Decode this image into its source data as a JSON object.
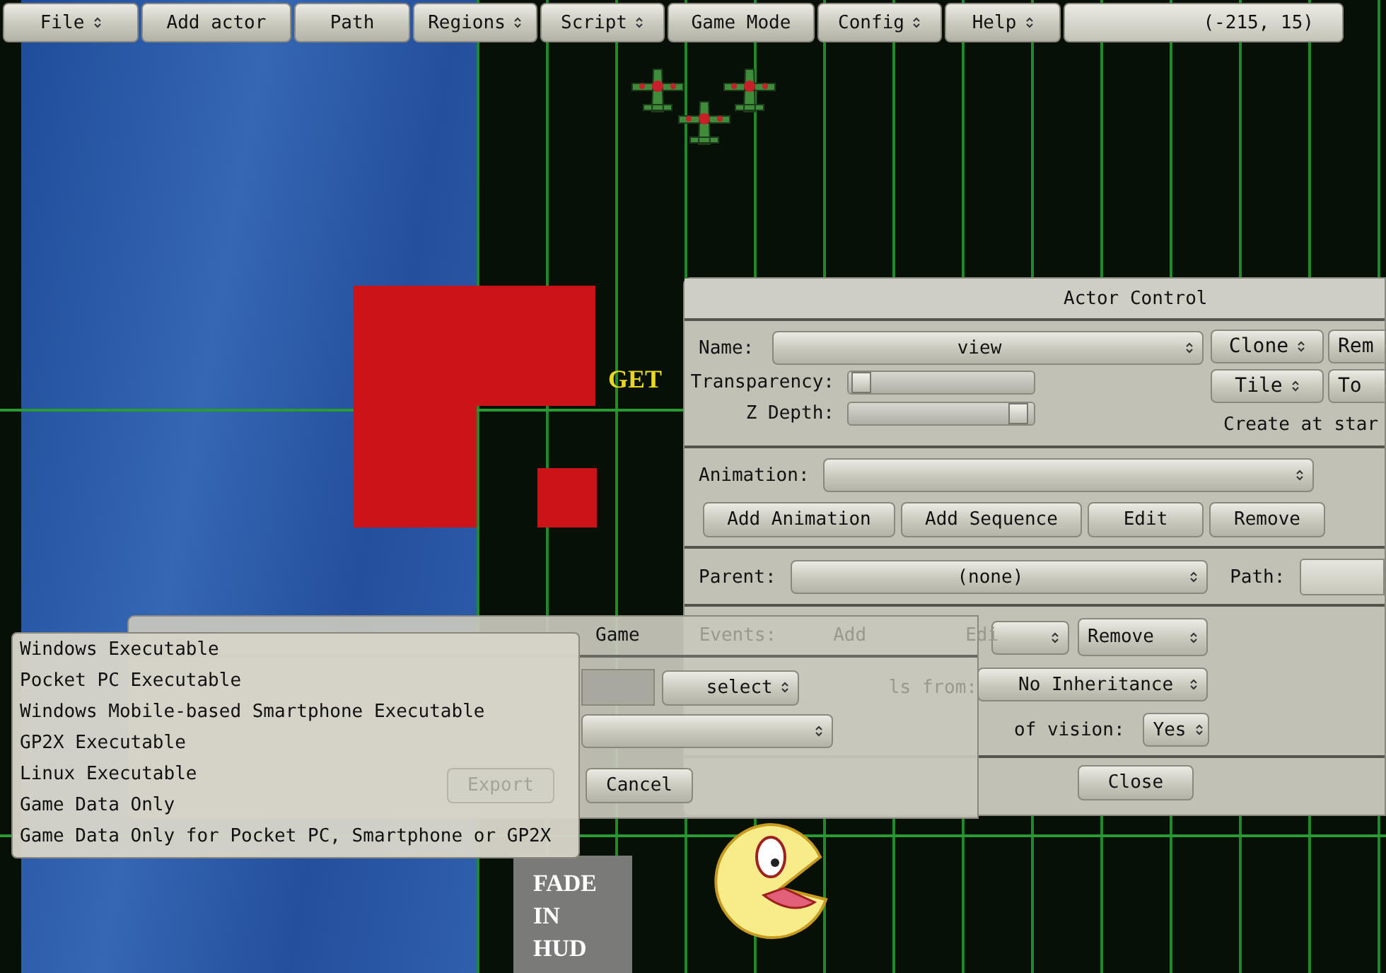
{
  "menu_bar": {
    "items": [
      {
        "label": "File",
        "has_menu": true
      },
      {
        "label": "Add actor",
        "has_menu": false
      },
      {
        "label": "Path",
        "has_menu": false
      },
      {
        "label": "Regions",
        "has_menu": true
      },
      {
        "label": "Script",
        "has_menu": true
      },
      {
        "label": "Game Mode",
        "has_menu": false
      },
      {
        "label": "Config",
        "has_menu": true
      },
      {
        "label": "Help",
        "has_menu": true
      }
    ],
    "coordinates": "(-215, 15)"
  },
  "canvas": {
    "banner_text": "GET",
    "hud_label": "FADE IN HUD"
  },
  "actor_control": {
    "title": "Actor Control",
    "name_label": "Name:",
    "name_value": "view",
    "side_buttons": [
      {
        "label": "Clone",
        "has_menu": true
      },
      {
        "label": "Rem",
        "has_menu": false
      },
      {
        "label": "Tile",
        "has_menu": true
      },
      {
        "label": "To",
        "has_menu": false
      }
    ],
    "transparency": {
      "label": "Transparency:",
      "level": 0.02
    },
    "z_depth": {
      "label": "Z Depth:",
      "level": 0.97
    },
    "create_label": "Create at star",
    "animation_label": "Animation:",
    "animation_buttons": [
      "Add Animation",
      "Add Sequence",
      "Edit",
      "Remove"
    ],
    "parent_label": "Parent:",
    "parent_value": "(none)",
    "path_label": "Path:",
    "events_label": "Events:",
    "events_buttons": [
      "Add",
      "Edi"
    ],
    "events_remove": "Remove",
    "inherit_label": "ls from:",
    "inherit_value": "No Inheritance",
    "vision_label": "of vision:",
    "vision_value": "Yes",
    "close": "Close"
  },
  "export_dialog": {
    "title": "Game",
    "select": "select",
    "export": {
      "label": "Export",
      "disabled": true
    },
    "cancel": "Cancel"
  },
  "export_menu": {
    "items": [
      "Windows Executable",
      "Pocket PC Executable",
      "Windows Mobile-based Smartphone Executable",
      "GP2X Executable",
      "Linux Executable",
      "Game Data Only",
      "Game Data Only for Pocket PC, Smartphone or GP2X"
    ]
  }
}
